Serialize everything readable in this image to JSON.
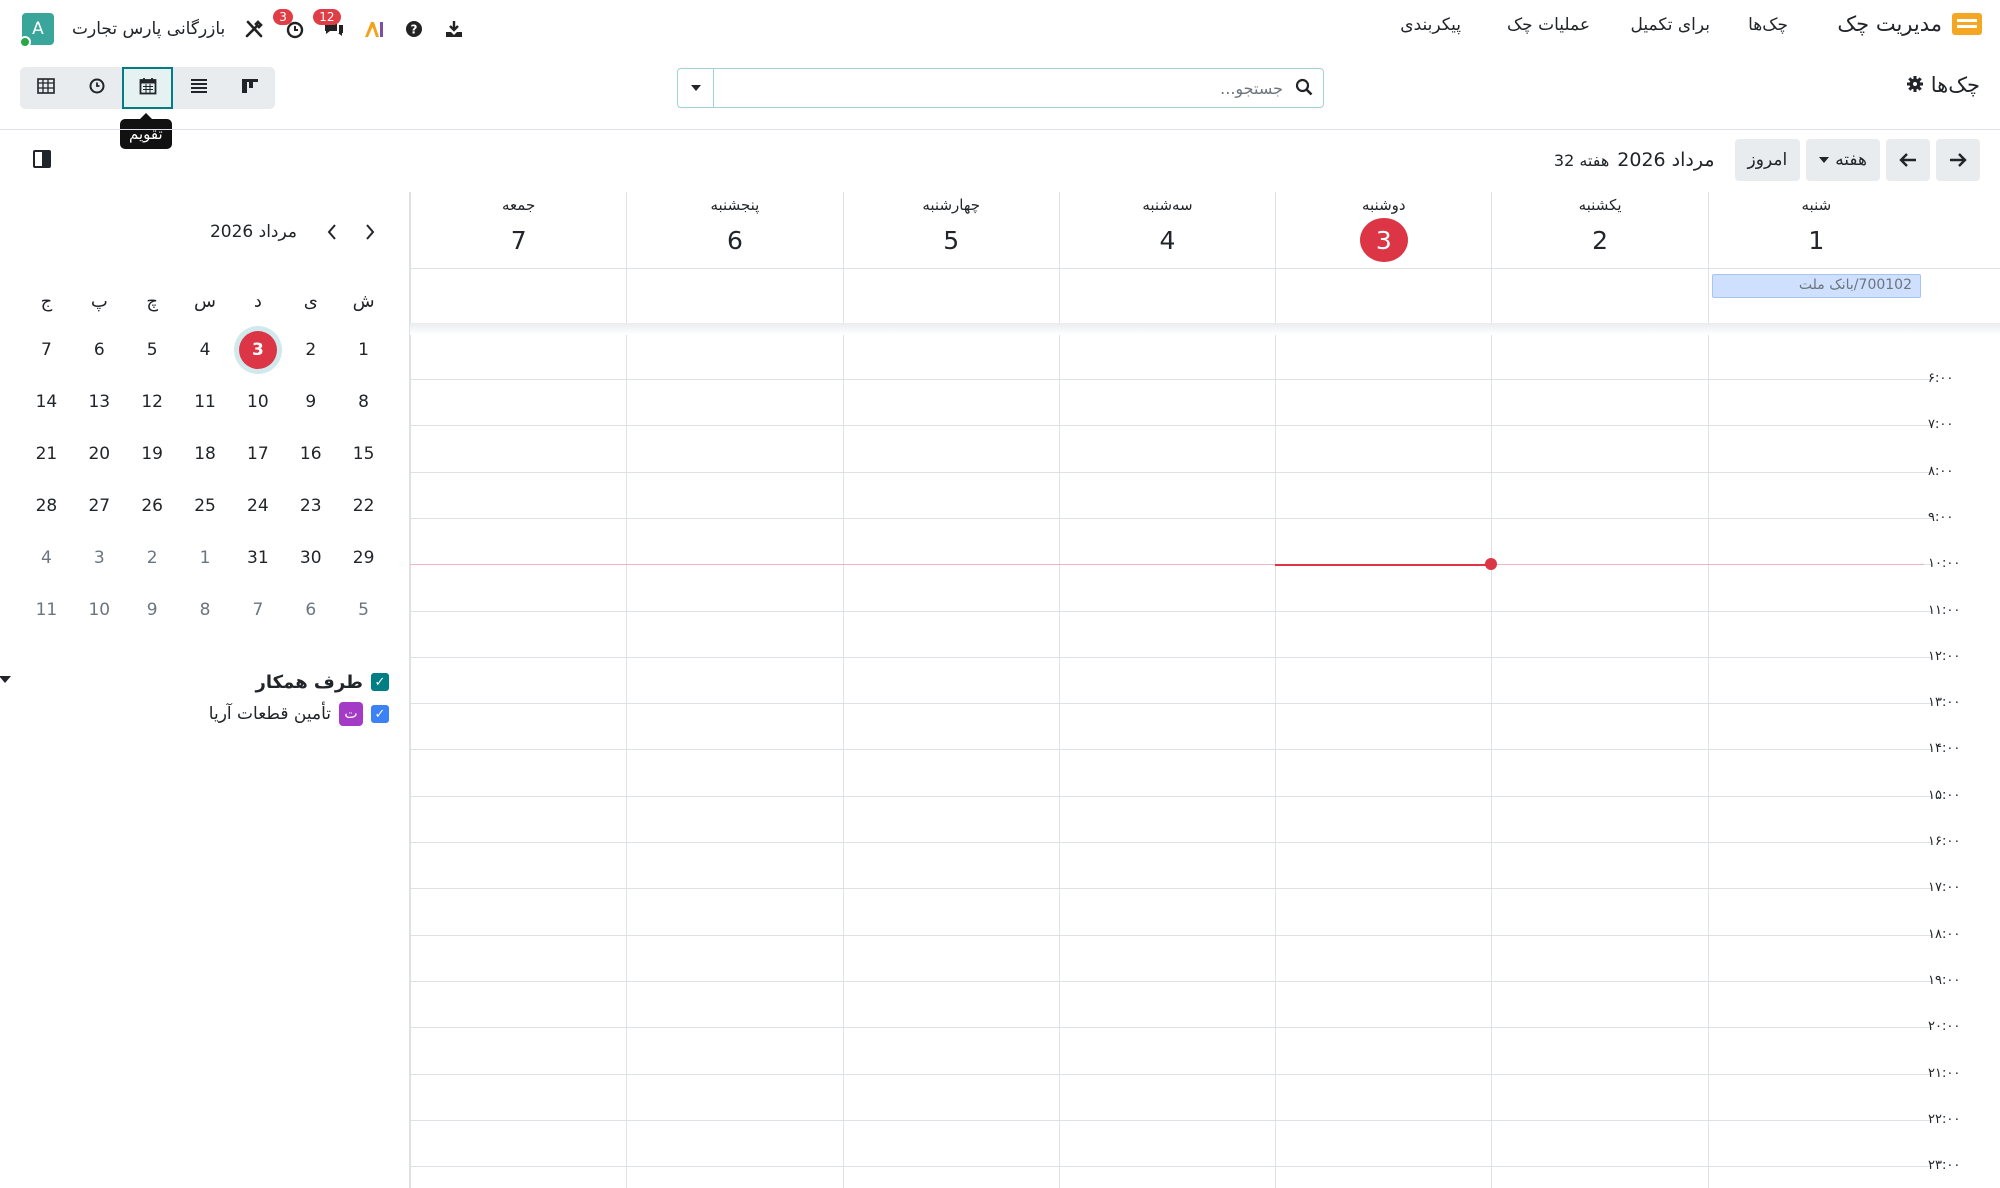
{
  "app": {
    "title": "مدیریت چک",
    "menu": [
      "چک‌ها",
      "برای تکمیل",
      "عملیات چک",
      "پیکربندی"
    ],
    "company": "بازرگانی پارس تجارت",
    "avatar_letter": "A",
    "badges": {
      "messages": "12",
      "activities": "3"
    }
  },
  "control": {
    "page_title": "چک‌ها",
    "search_placeholder": "جستجو...",
    "views": [
      "pivot-view",
      "activity-view",
      "calendar-view",
      "list-view",
      "kanban-view"
    ],
    "active_view": "calendar-view",
    "tooltip": "تقویم"
  },
  "toolbar": {
    "today": "امروز",
    "scale": "هفته",
    "month_year": "مرداد 2026",
    "week_label": "هفته 32"
  },
  "week": {
    "days": [
      {
        "name": "شنبه",
        "num": "1"
      },
      {
        "name": "یکشنبه",
        "num": "2"
      },
      {
        "name": "دوشنبه",
        "num": "3",
        "today": true
      },
      {
        "name": "سه‌شنبه",
        "num": "4"
      },
      {
        "name": "چهارشنبه",
        "num": "5"
      },
      {
        "name": "پنجشنبه",
        "num": "6"
      },
      {
        "name": "جمعه",
        "num": "7"
      }
    ],
    "allday_event": "700102/بانک ملت",
    "hours": [
      "۶:۰۰",
      "۷:۰۰",
      "۸:۰۰",
      "۹:۰۰",
      "۱۰:۰۰",
      "۱۱:۰۰",
      "۱۲:۰۰",
      "۱۳:۰۰",
      "۱۴:۰۰",
      "۱۵:۰۰",
      "۱۶:۰۰",
      "۱۷:۰۰",
      "۱۸:۰۰",
      "۱۹:۰۰",
      "۲۰:۰۰",
      "۲۱:۰۰",
      "۲۲:۰۰",
      "۲۳:۰۰"
    ],
    "now_time": "10:00"
  },
  "mini_calendar": {
    "title": "مرداد 2026",
    "weekdays": [
      "ش",
      "ی",
      "د",
      "س",
      "چ",
      "پ",
      "ج"
    ],
    "weeks": [
      [
        "1",
        "2",
        "3",
        "4",
        "5",
        "6",
        "7"
      ],
      [
        "8",
        "9",
        "10",
        "11",
        "12",
        "13",
        "14"
      ],
      [
        "15",
        "16",
        "17",
        "18",
        "19",
        "20",
        "21"
      ],
      [
        "22",
        "23",
        "24",
        "25",
        "26",
        "27",
        "28"
      ],
      [
        "29",
        "30",
        "31",
        "1",
        "2",
        "3",
        "4"
      ],
      [
        "5",
        "6",
        "7",
        "8",
        "9",
        "10",
        "11"
      ]
    ],
    "today": "3"
  },
  "filters": {
    "title": "طرف همکار",
    "items": [
      {
        "chip": "ت",
        "label": "تأمین قطعات آریا"
      }
    ]
  },
  "colors": {
    "accent": "#017e84",
    "today": "#dc3545",
    "event": "#cfe0ff",
    "partner_chip": "#a43bc7"
  }
}
